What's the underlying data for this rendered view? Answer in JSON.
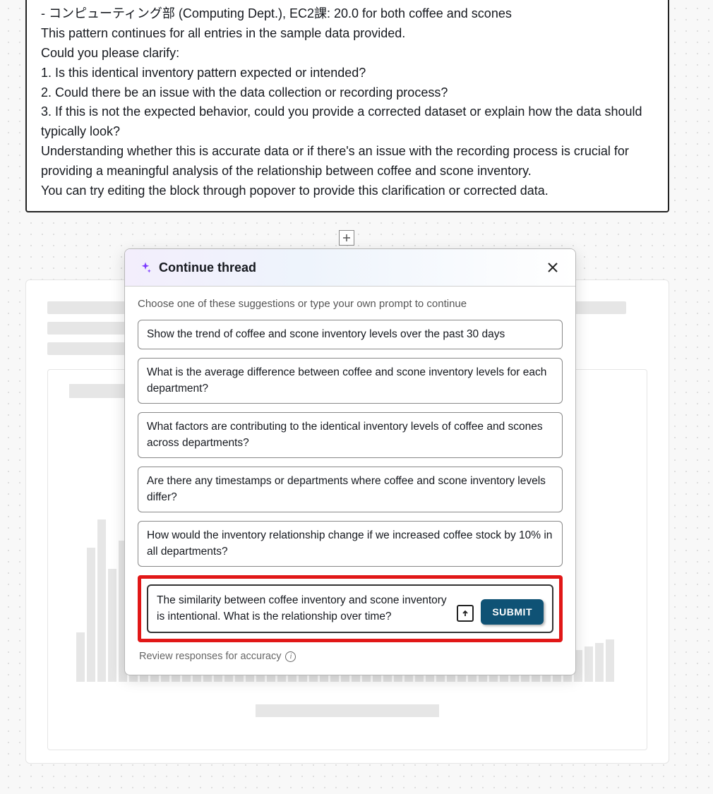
{
  "top_block": {
    "lines": [
      "- コンピューティング部 (Computing Dept.), EC2課: 20.0 for both coffee and scones",
      "This pattern continues for all entries in the sample data provided.",
      "Could you please clarify:",
      "1. Is this identical inventory pattern expected or intended?",
      "2. Could there be an issue with the data collection or recording process?",
      "3. If this is not the expected behavior, could you provide a corrected dataset or explain how the data should typically look?",
      "Understanding whether this is accurate data or if there's an issue with the recording process is crucial for providing a meaningful analysis of the relationship between coffee and scone inventory.",
      "You can try editing the block through popover to provide this clarification or corrected data."
    ]
  },
  "popover": {
    "title": "Continue thread",
    "instruction": "Choose one of these suggestions or type your own prompt to continue",
    "suggestions": [
      "Show the trend of coffee and scone inventory levels over the past 30 days",
      "What is the average difference between coffee and scone inventory levels for each department?",
      "What factors are contributing to the identical inventory levels of coffee and scones across departments?",
      "Are there any timestamps or departments where coffee and scone inventory levels differ?",
      "How would the inventory relationship change if we increased coffee stock by 10% in all departments?"
    ],
    "input_value": "The similarity between coffee inventory and scone inventory is intentional. What is the relationship over time?",
    "submit_label": "SUBMIT",
    "review_note": "Review responses for accuracy"
  },
  "skeleton": {
    "bar_heights": [
      70,
      190,
      230,
      160,
      200,
      50,
      90,
      60,
      40,
      70,
      110,
      90,
      60,
      70,
      60,
      45,
      80,
      95,
      55,
      60,
      65,
      90,
      85,
      70,
      60,
      55,
      65,
      50,
      55,
      60,
      45,
      50,
      55,
      60,
      50,
      55,
      75,
      90,
      100,
      85,
      80,
      95,
      60,
      50,
      55,
      45,
      50,
      45,
      50,
      55,
      60
    ]
  }
}
